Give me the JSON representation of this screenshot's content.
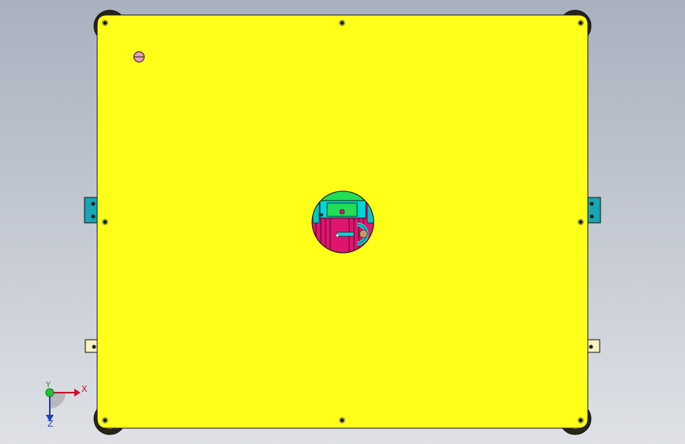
{
  "view": {
    "background_top": "#a9b1bf",
    "background_bottom": "#dfe1e6",
    "plate_color": "#ffff1a",
    "cutout_colors": [
      "#00e0e0",
      "#ff1493",
      "#22dd55",
      "#c59a6a"
    ]
  },
  "triad": {
    "x_label": "X",
    "y_label": "Y",
    "z_label": "Z",
    "x_color": "#c8102e",
    "y_color": "#1a8f1a",
    "z_color": "#1f3fbf"
  }
}
